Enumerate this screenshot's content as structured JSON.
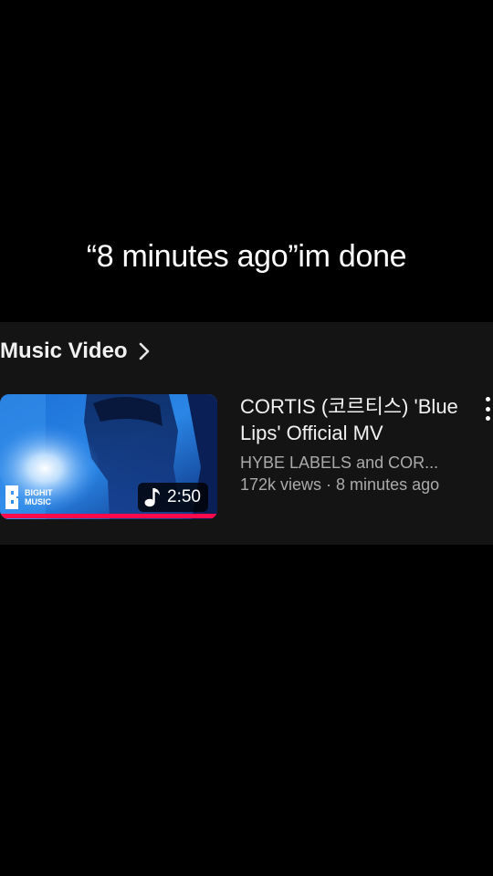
{
  "overlay": {
    "caption": "“8 minutes ago”im done"
  },
  "section": {
    "title": "Music Video",
    "chevron_icon": "chevron-right-icon"
  },
  "video": {
    "title": "CORTIS (코르티스) 'Blue Lips' Official MV",
    "channel": "HYBE LABELS and COR...",
    "meta": "172k views · 8 minutes ago",
    "duration": "2:50",
    "duration_icon": "music-note-icon",
    "thumbnail_logo_text": "BIGHIT MUSIC",
    "progress_fraction": 1.0,
    "progress_color": "#ff0a4a",
    "menu_icon": "more-vertical-icon"
  },
  "colors": {
    "background": "#000000",
    "panel": "#141414",
    "secondary_text": "#aaaaaa",
    "primary_text": "#f1f1f1"
  }
}
